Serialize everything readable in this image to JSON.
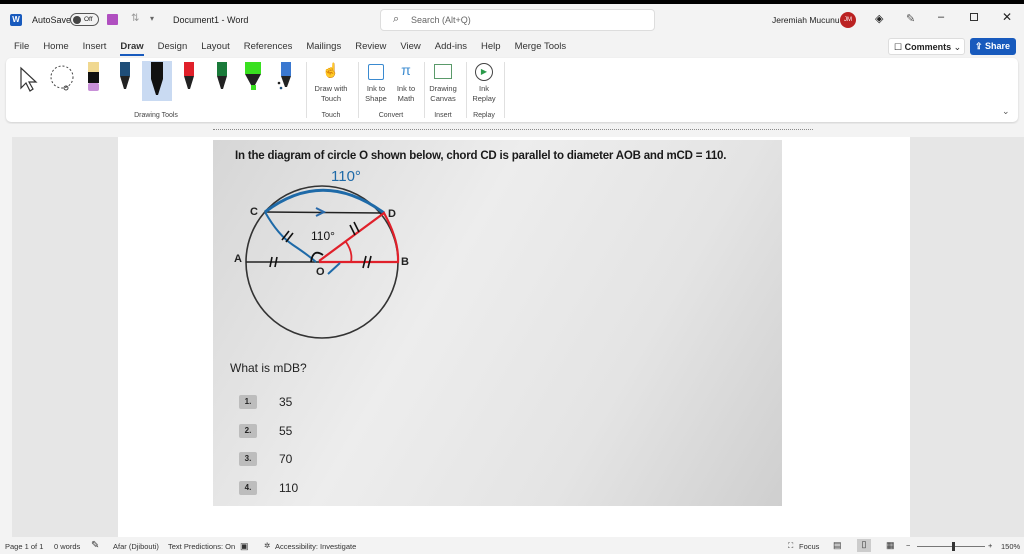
{
  "title_bar": {
    "autosave": "AutoSave",
    "toggle": "Off",
    "doc_title": "Document1 - Word",
    "search_placeholder": "Search (Alt+Q)",
    "user": "Jeremiah Mucunu",
    "avatar": "JM"
  },
  "tabs": [
    "File",
    "Home",
    "Insert",
    "Draw",
    "Design",
    "Layout",
    "References",
    "Mailings",
    "Review",
    "View",
    "Add-ins",
    "Help",
    "Merge Tools"
  ],
  "active_tab": "Draw",
  "actions": {
    "comments": "Comments",
    "share": "Share"
  },
  "ribbon": {
    "groups": [
      {
        "label": "Drawing Tools"
      },
      {
        "label": "Touch",
        "buttons": [
          {
            "line1": "Draw with",
            "line2": "Touch"
          }
        ]
      },
      {
        "label": "Convert",
        "buttons": [
          {
            "line1": "Ink to",
            "line2": "Shape"
          },
          {
            "line1": "Ink to",
            "line2": "Math"
          }
        ]
      },
      {
        "label": "Insert",
        "buttons": [
          {
            "line1": "Drawing",
            "line2": "Canvas"
          }
        ]
      },
      {
        "label": "Replay",
        "buttons": [
          {
            "line1": "Ink",
            "line2": "Replay"
          }
        ]
      }
    ],
    "pens": [
      {
        "color": "#f0d890"
      },
      {
        "color": "#1f4e79"
      },
      {
        "color": "#111111"
      },
      {
        "color": "#e0202a"
      },
      {
        "color": "#1a7a3a"
      },
      {
        "color": "#39e020"
      },
      {
        "color": "#3a78d0"
      }
    ]
  },
  "document": {
    "question_intro": "In the diagram of circle O shown below, chord CD is parallel to diameter AOB and mCD = 110.",
    "handwritten_arc": "110°",
    "handwritten_angle": "110°",
    "points": [
      "C",
      "D",
      "A",
      "O",
      "B"
    ],
    "question": "What is mDB?",
    "choices": [
      {
        "num": "1.",
        "value": "35"
      },
      {
        "num": "2.",
        "value": "55"
      },
      {
        "num": "3.",
        "value": "70"
      },
      {
        "num": "4.",
        "value": "110"
      }
    ]
  },
  "status_bar": {
    "page": "Page 1 of 1",
    "words": "0 words",
    "language": "Afar (Djibouti)",
    "predictions": "Text Predictions: On",
    "accessibility": "Accessibility: Investigate",
    "focus": "Focus",
    "zoom": "150%"
  }
}
